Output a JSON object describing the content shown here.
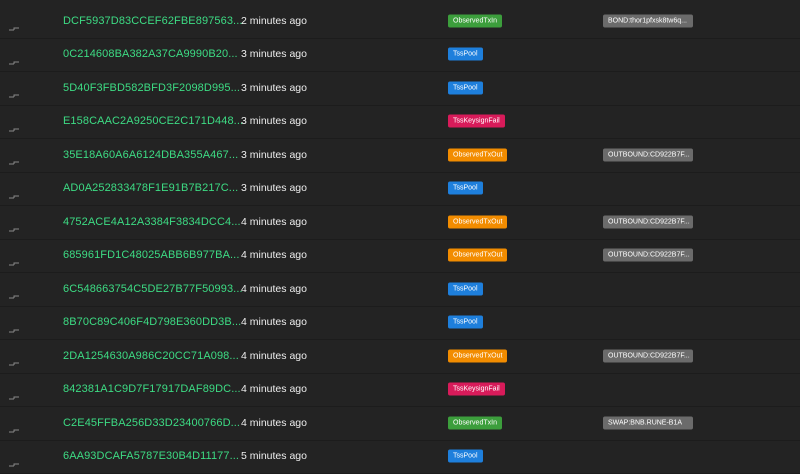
{
  "colors": {
    "background": "#232323",
    "hash": "#3ddc84",
    "time": "#eeeeee",
    "memo_bg": "#6b6b6b",
    "ObservedTxIn": "#3c9e3c",
    "TssPool": "#1e7fdc",
    "TssKeysignFail": "#d81b5a",
    "ObservedTxOut": "#f28c00"
  },
  "rows": [
    {
      "icon": "transfer-arrow-icon",
      "hash": "DCF5937D83CCEF62FBE897563...",
      "time": "2 minutes ago",
      "type": "ObservedTxIn",
      "memo": "BOND:thor1pfxsk8tw6q..."
    },
    {
      "icon": "transfer-arrow-icon",
      "hash": "0C214608BA382A37CA9990B20...",
      "time": "3 minutes ago",
      "type": "TssPool",
      "memo": ""
    },
    {
      "icon": "transfer-arrow-icon",
      "hash": "5D40F3FBD582BFD3F2098D995...",
      "time": "3 minutes ago",
      "type": "TssPool",
      "memo": ""
    },
    {
      "icon": "transfer-arrow-icon",
      "hash": "E158CAAC2A9250CE2C171D448...",
      "time": "3 minutes ago",
      "type": "TssKeysignFail",
      "memo": ""
    },
    {
      "icon": "transfer-arrow-icon",
      "hash": "35E18A60A6A6124DBA355A467...",
      "time": "3 minutes ago",
      "type": "ObservedTxOut",
      "memo": "OUTBOUND:CD922B7F..."
    },
    {
      "icon": "transfer-arrow-icon",
      "hash": "AD0A252833478F1E91B7B217C...",
      "time": "3 minutes ago",
      "type": "TssPool",
      "memo": ""
    },
    {
      "icon": "transfer-arrow-icon",
      "hash": "4752ACE4A12A3384F3834DCC4...",
      "time": "4 minutes ago",
      "type": "ObservedTxOut",
      "memo": "OUTBOUND:CD922B7F..."
    },
    {
      "icon": "transfer-arrow-icon",
      "hash": "685961FD1C48025ABB6B977BA...",
      "time": "4 minutes ago",
      "type": "ObservedTxOut",
      "memo": "OUTBOUND:CD922B7F..."
    },
    {
      "icon": "transfer-arrow-icon",
      "hash": "6C548663754C5DE27B77F50993...",
      "time": "4 minutes ago",
      "type": "TssPool",
      "memo": ""
    },
    {
      "icon": "transfer-arrow-icon",
      "hash": "8B70C89C406F4D798E360DD3B...",
      "time": "4 minutes ago",
      "type": "TssPool",
      "memo": ""
    },
    {
      "icon": "transfer-arrow-icon",
      "hash": "2DA1254630A986C20CC71A098...",
      "time": "4 minutes ago",
      "type": "ObservedTxOut",
      "memo": "OUTBOUND:CD922B7F..."
    },
    {
      "icon": "transfer-arrow-icon",
      "hash": "842381A1C9D7F17917DAF89DC...",
      "time": "4 minutes ago",
      "type": "TssKeysignFail",
      "memo": ""
    },
    {
      "icon": "transfer-arrow-icon",
      "hash": "C2E45FFBA256D33D23400766D...",
      "time": "4 minutes ago",
      "type": "ObservedTxIn",
      "memo": "SWAP:BNB.RUNE-B1A"
    },
    {
      "icon": "transfer-arrow-icon",
      "hash": "6AA93DCAFA5787E30B4D11177...",
      "time": "5 minutes ago",
      "type": "TssPool",
      "memo": ""
    }
  ]
}
